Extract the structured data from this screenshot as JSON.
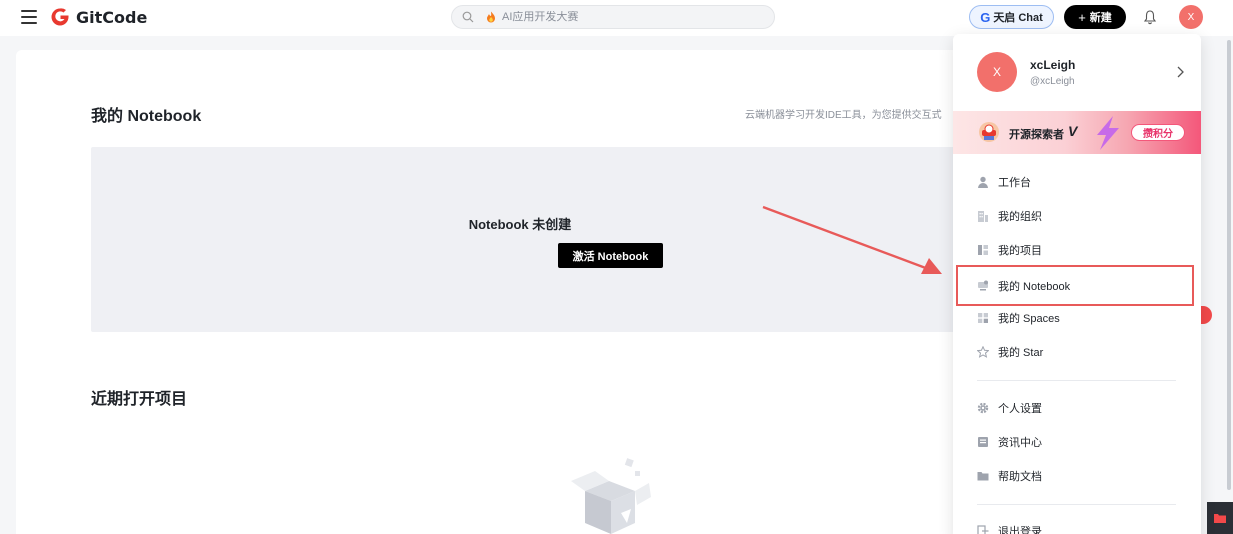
{
  "header": {
    "logo_text": "GitCode",
    "search_placeholder": "AI应用开发大赛",
    "chat_label": "天启 Chat",
    "chat_g": "G",
    "new_label": "新建",
    "avatar_initial": "X"
  },
  "main": {
    "notebook_title": "我的 Notebook",
    "notebook_desc": "云端机器学习开发IDE工具，为您提供交互式",
    "empty_title": "Notebook 未创建",
    "activate_label": "激活 Notebook",
    "recent_title": "近期打开项目"
  },
  "profile": {
    "initial": "X",
    "name": "xcLeigh",
    "handle": "@xcLeigh"
  },
  "banner": {
    "text": "开源探索者",
    "badge": "V",
    "button": "攒积分"
  },
  "menu": {
    "items": [
      {
        "label": "工作台",
        "icon": "user-icon"
      },
      {
        "label": "我的组织",
        "icon": "building-icon"
      },
      {
        "label": "我的项目",
        "icon": "project-icon"
      },
      {
        "label": "我的 Notebook",
        "icon": "notebook-icon"
      },
      {
        "label": "我的 Spaces",
        "icon": "grid-icon"
      },
      {
        "label": "我的 Star",
        "icon": "star-icon"
      },
      {
        "label": "个人设置",
        "icon": "gear-icon"
      },
      {
        "label": "资讯中心",
        "icon": "news-icon"
      },
      {
        "label": "帮助文档",
        "icon": "folder-icon"
      },
      {
        "label": "退出登录",
        "icon": "logout-icon"
      }
    ]
  },
  "colors": {
    "brand_red": "#e8392f",
    "highlight_red": "#e85a59",
    "accent_blue": "#2b64f0"
  }
}
